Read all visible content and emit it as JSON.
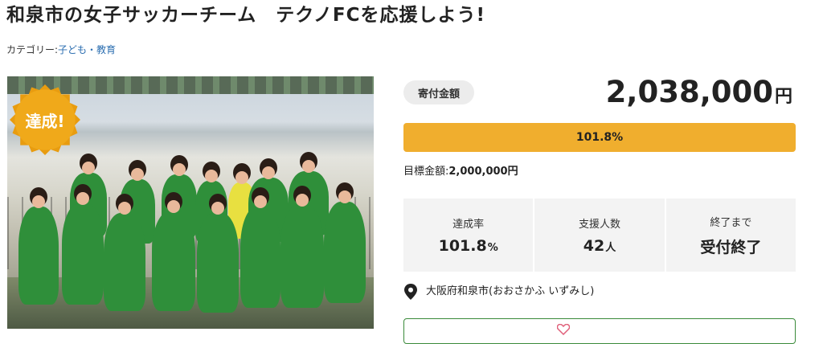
{
  "project": {
    "title": "和泉市の女子サッカーチーム　テクノFCを応援しよう!",
    "category_label": "カテゴリー:",
    "category_value": "子ども・教育",
    "badge": "達成!"
  },
  "funding": {
    "label": "寄付金額",
    "amount": "2,038,000",
    "amount_unit": "円",
    "progress_text": "101.8%",
    "progress_fraction": 1.018,
    "target_label": "目標金額:",
    "target_value": "2,000,000円"
  },
  "stats": [
    {
      "key": "達成率",
      "value": "101.8",
      "unit": "%"
    },
    {
      "key": "支援人数",
      "value": "42",
      "unit": "人"
    },
    {
      "key": "終了まで",
      "value": "受付終了",
      "unit": ""
    }
  ],
  "location": "大阪府和泉市(おおさかふ いずみし)",
  "colors": {
    "accent": "#f0ae2e",
    "cta_border": "#3a8a3a",
    "link": "#2a6db0"
  }
}
